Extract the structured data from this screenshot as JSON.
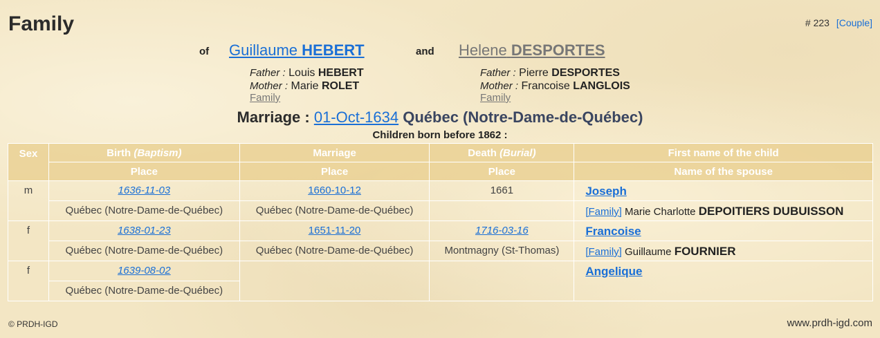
{
  "header": {
    "title": "Family",
    "record_number": "# 223",
    "couple_link": "[Couple]"
  },
  "spouses": {
    "of_label": "of",
    "and_label": "and",
    "husband": {
      "first": "Guillaume",
      "last": "HEBERT"
    },
    "wife": {
      "first": "Helene",
      "last": "DESPORTES"
    }
  },
  "husband_parents": {
    "father_label": "Father :",
    "father_first": "Louis",
    "father_last": "HEBERT",
    "mother_label": "Mother :",
    "mother_first": "Marie",
    "mother_last": "ROLET",
    "family_link": "Family"
  },
  "wife_parents": {
    "father_label": "Father :",
    "father_first": "Pierre",
    "father_last": "DESPORTES",
    "mother_label": "Mother :",
    "mother_first": "Francoise",
    "mother_last": "LANGLOIS",
    "family_link": "Family"
  },
  "marriage": {
    "label": "Marriage :",
    "date": "01-Oct-1634",
    "place": "Québec (Notre-Dame-de-Québec)"
  },
  "children_caption": "Children born before 1862 :",
  "table": {
    "headers": {
      "sex": "Sex",
      "birth": "Birth",
      "baptism": "(Baptism)",
      "marriage": "Marriage",
      "death": "Death",
      "burial": "(Burial)",
      "first_name": "First name of the child",
      "place": "Place",
      "spouse": "Name of the spouse"
    },
    "rows": [
      {
        "sex": "m",
        "birth_date": "1636-11-03",
        "birth_place": "Québec (Notre-Dame-de-Québec)",
        "marriage_date": "1660-10-12",
        "marriage_place": "Québec (Notre-Dame-de-Québec)",
        "death_date": "1661",
        "death_place": "",
        "child_name": "Joseph",
        "family_link": "[Family]",
        "spouse_first": "Marie Charlotte",
        "spouse_last": "DEPOITIERS DUBUISSON"
      },
      {
        "sex": "f",
        "birth_date": "1638-01-23",
        "birth_place": "Québec (Notre-Dame-de-Québec)",
        "marriage_date": "1651-11-20",
        "marriage_place": "Québec (Notre-Dame-de-Québec)",
        "death_date": "1716-03-16",
        "death_place": "Montmagny (St-Thomas)",
        "child_name": "Francoise",
        "family_link": "[Family]",
        "spouse_first": "Guillaume",
        "spouse_last": "FOURNIER"
      },
      {
        "sex": "f",
        "birth_date": "1639-08-02",
        "birth_place": "Québec (Notre-Dame-de-Québec)",
        "marriage_date": "",
        "marriage_place": "",
        "death_date": "",
        "death_place": "",
        "child_name": "Angelique",
        "family_link": "",
        "spouse_first": "",
        "spouse_last": ""
      }
    ]
  },
  "footer": {
    "copyright": "© PRDH-IGD",
    "site": "www.prdh-igd.com"
  },
  "colors": {
    "link": "#1a6fd6",
    "muted_link": "#777777",
    "header_bg": "#e8cd8c",
    "parchment": "#f3e6c4"
  }
}
